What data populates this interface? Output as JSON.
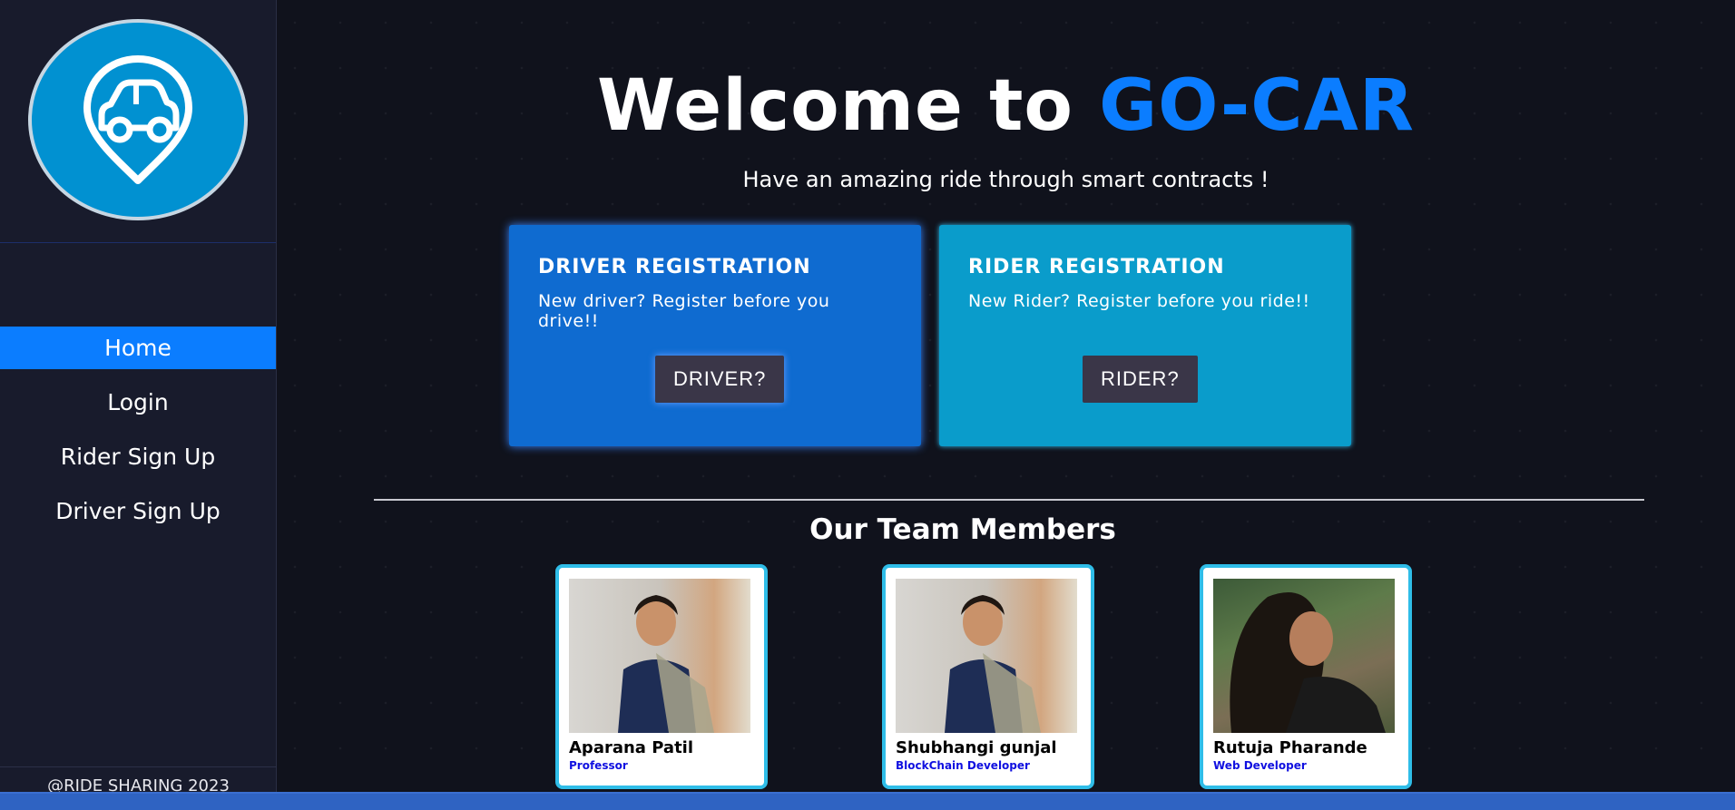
{
  "sidebar": {
    "logo_icon": "car-location-pin-icon",
    "nav": [
      {
        "label": "Home",
        "active": true
      },
      {
        "label": "Login",
        "active": false
      },
      {
        "label": "Rider Sign Up",
        "active": false
      },
      {
        "label": "Driver Sign Up",
        "active": false
      }
    ],
    "footer": "@RIDE SHARING 2023"
  },
  "hero": {
    "title_prefix": "Welcome to ",
    "title_brand": "GO-CAR",
    "subtitle": "Have an amazing ride through smart contracts !"
  },
  "cards": {
    "driver": {
      "title": "DRIVER REGISTRATION",
      "text": "New driver? Register before you drive!!",
      "button": "DRIVER?"
    },
    "rider": {
      "title": "RIDER REGISTRATION",
      "text": "New Rider? Register before you ride!!",
      "button": "RIDER?"
    }
  },
  "team": {
    "heading": "Our Team Members",
    "members": [
      {
        "name": "Aparana Patil",
        "role": "Professor"
      },
      {
        "name": "Shubhangi gunjal",
        "role": "BlockChain Developer"
      },
      {
        "name": "Rutuja Pharande",
        "role": "Web Developer"
      }
    ]
  },
  "colors": {
    "accent": "#0b7dff",
    "driver_card": "#0f6bd0",
    "rider_card": "#0a9ccb",
    "sidebar_bg": "#181b2c",
    "page_bg": "#10121c"
  }
}
